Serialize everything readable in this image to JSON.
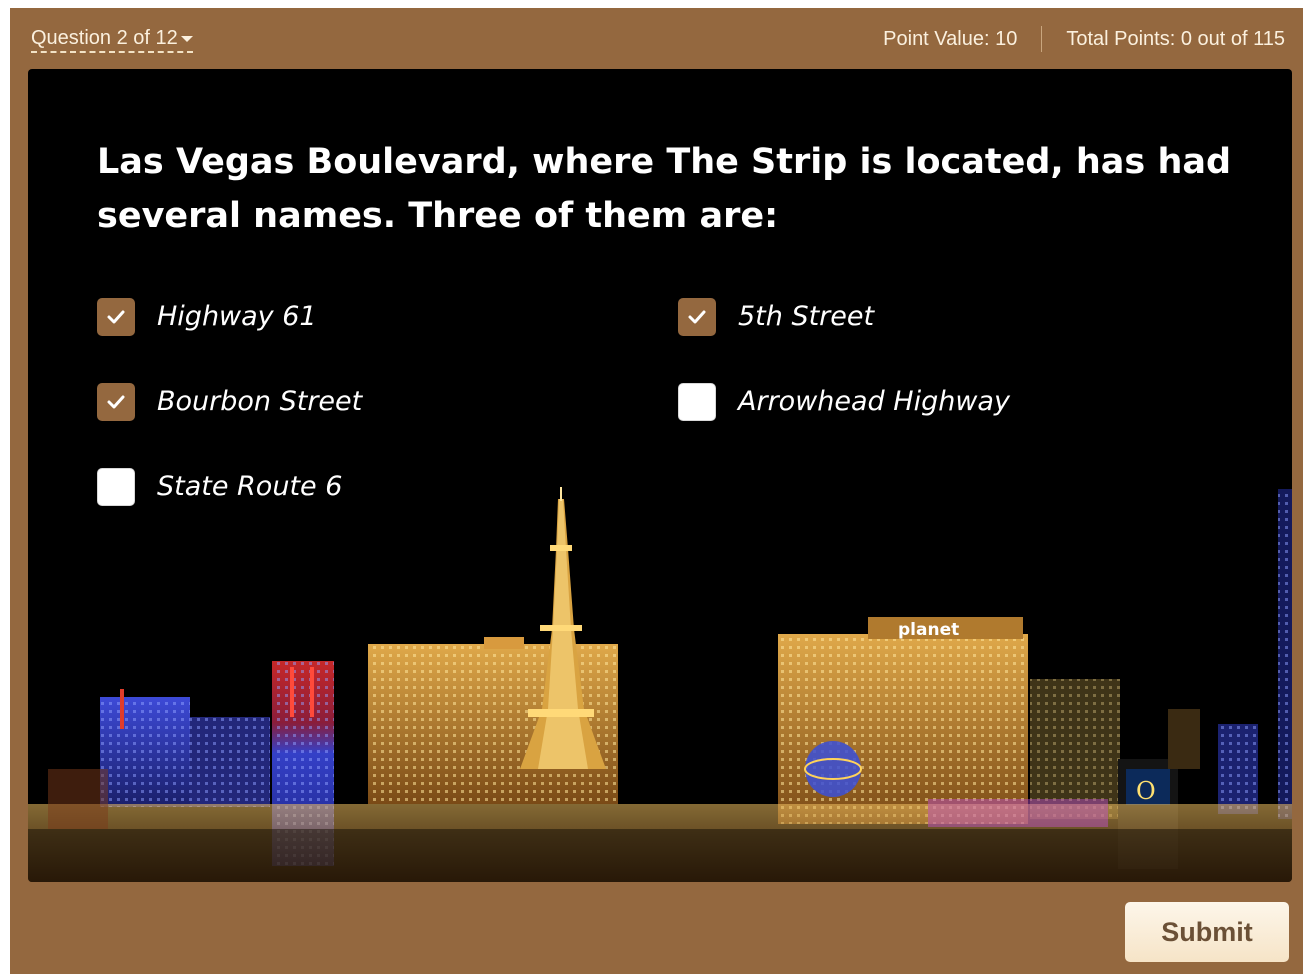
{
  "header": {
    "question_nav": "Question 2 of 12",
    "point_value": "Point Value: 10",
    "total_points": "Total Points: 0 out of 115"
  },
  "question": {
    "text": "Las Vegas Boulevard, where The Strip is located, has had several names. Three of them are:"
  },
  "options": [
    {
      "label": "Highway 61",
      "checked": true
    },
    {
      "label": "5th Street",
      "checked": true
    },
    {
      "label": "Bourbon Street",
      "checked": true
    },
    {
      "label": "Arrowhead Highway",
      "checked": false
    },
    {
      "label": "State Route 6",
      "checked": false
    }
  ],
  "background_image": {
    "signs": [
      "planet",
      "O"
    ]
  },
  "footer": {
    "submit_label": "Submit"
  },
  "colors": {
    "frame": "#94683f",
    "checkbox_checked": "#94683f",
    "slide_background": "#000000",
    "submit_background": "#f6e4c7"
  },
  "icons": {
    "checkmark": "check-icon",
    "dropdown": "chevron-down-icon"
  }
}
